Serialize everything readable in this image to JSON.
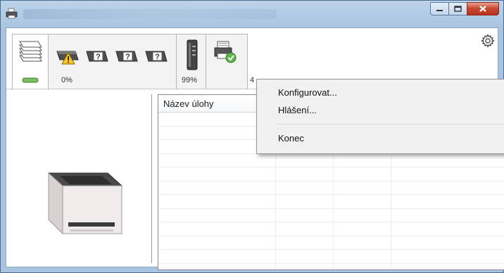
{
  "window": {
    "title": ""
  },
  "tabs": [
    {
      "name": "status",
      "percent": ""
    },
    {
      "name": "toner",
      "percent": "0%"
    },
    {
      "name": "paper",
      "percent": "99%"
    },
    {
      "name": "job-status",
      "percent": "4"
    }
  ],
  "jobs_table": {
    "columns": [
      "Název úlohy",
      "",
      "",
      ""
    ],
    "rows": []
  },
  "context_menu": {
    "items": [
      "Konfigurovat...",
      "Hlášení...",
      "Konec"
    ]
  }
}
